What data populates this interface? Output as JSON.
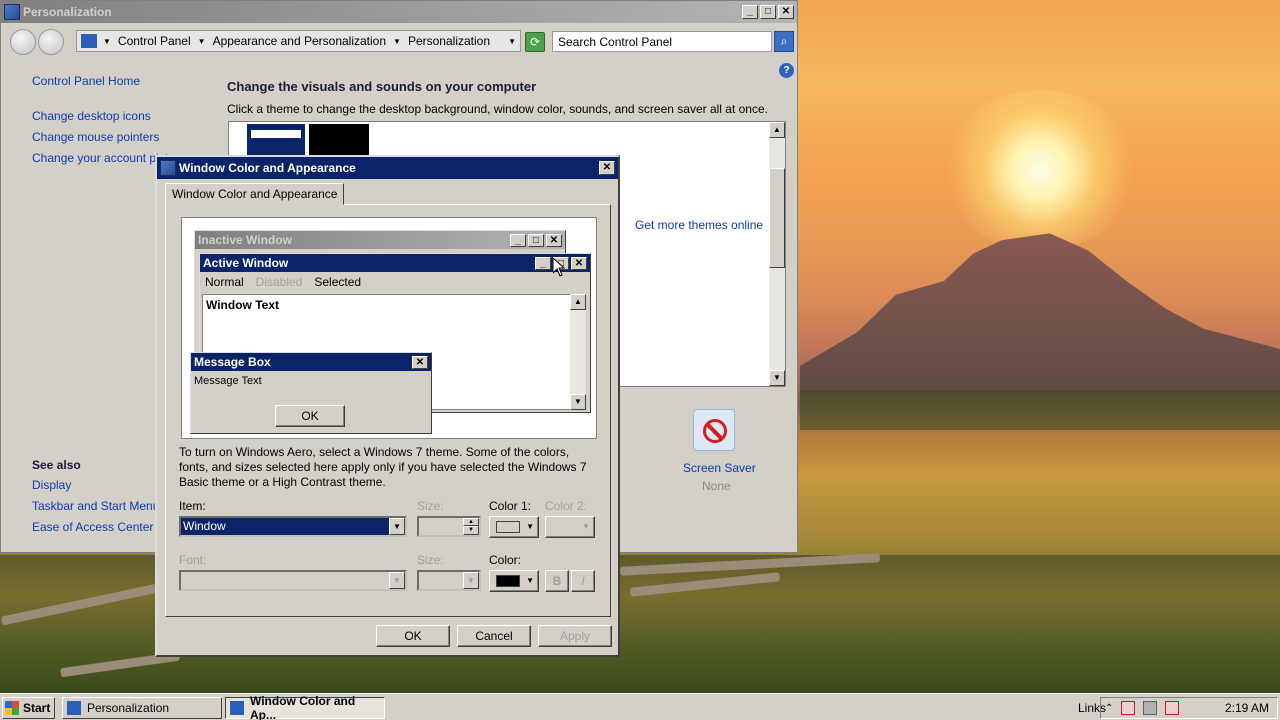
{
  "cp": {
    "title": "Personalization",
    "address": [
      "Control Panel",
      "Appearance and Personalization",
      "Personalization"
    ],
    "search_placeholder": "Search Control Panel",
    "sidebar": {
      "home": "Control Panel Home",
      "links": [
        "Change desktop icons",
        "Change mouse pointers",
        "Change your account pict"
      ],
      "see_also_title": "See also",
      "see_also": [
        "Display",
        "Taskbar and Start Menu",
        "Ease of Access Center"
      ]
    },
    "main": {
      "heading": "Change the visuals and sounds on your computer",
      "description": "Click a theme to change the desktop background, window color, sounds, and screen saver all at once.",
      "more_themes": "Get more themes online",
      "screen_saver_label": "Screen Saver",
      "screen_saver_value": "None"
    }
  },
  "dialog": {
    "title": "Window Color and Appearance",
    "tab": "Window Color and Appearance",
    "preview": {
      "inactive_title": "Inactive Window",
      "active_title": "Active Window",
      "menu": [
        "Normal",
        "Disabled",
        "Selected"
      ],
      "window_text": "Window Text",
      "msgbox_title": "Message Box",
      "msgbox_text": "Message Text",
      "msgbox_ok": "OK"
    },
    "info": "To turn on Windows Aero, select a Windows 7 theme.  Some of the colors, fonts, and sizes selected here apply only if you have selected the Windows 7 Basic theme or a High Contrast theme.",
    "labels": {
      "item": "Item:",
      "size": "Size:",
      "color1": "Color 1:",
      "color2": "Color 2:",
      "font": "Font:",
      "size2": "Size:",
      "color": "Color:",
      "bold": "B",
      "italic": "I"
    },
    "item_value": "Window",
    "buttons": {
      "ok": "OK",
      "cancel": "Cancel",
      "apply": "Apply"
    }
  },
  "taskbar": {
    "start": "Start",
    "tasks": [
      "Personalization",
      "Window Color and Ap..."
    ],
    "links": "Links",
    "clock": "2:19 AM"
  }
}
